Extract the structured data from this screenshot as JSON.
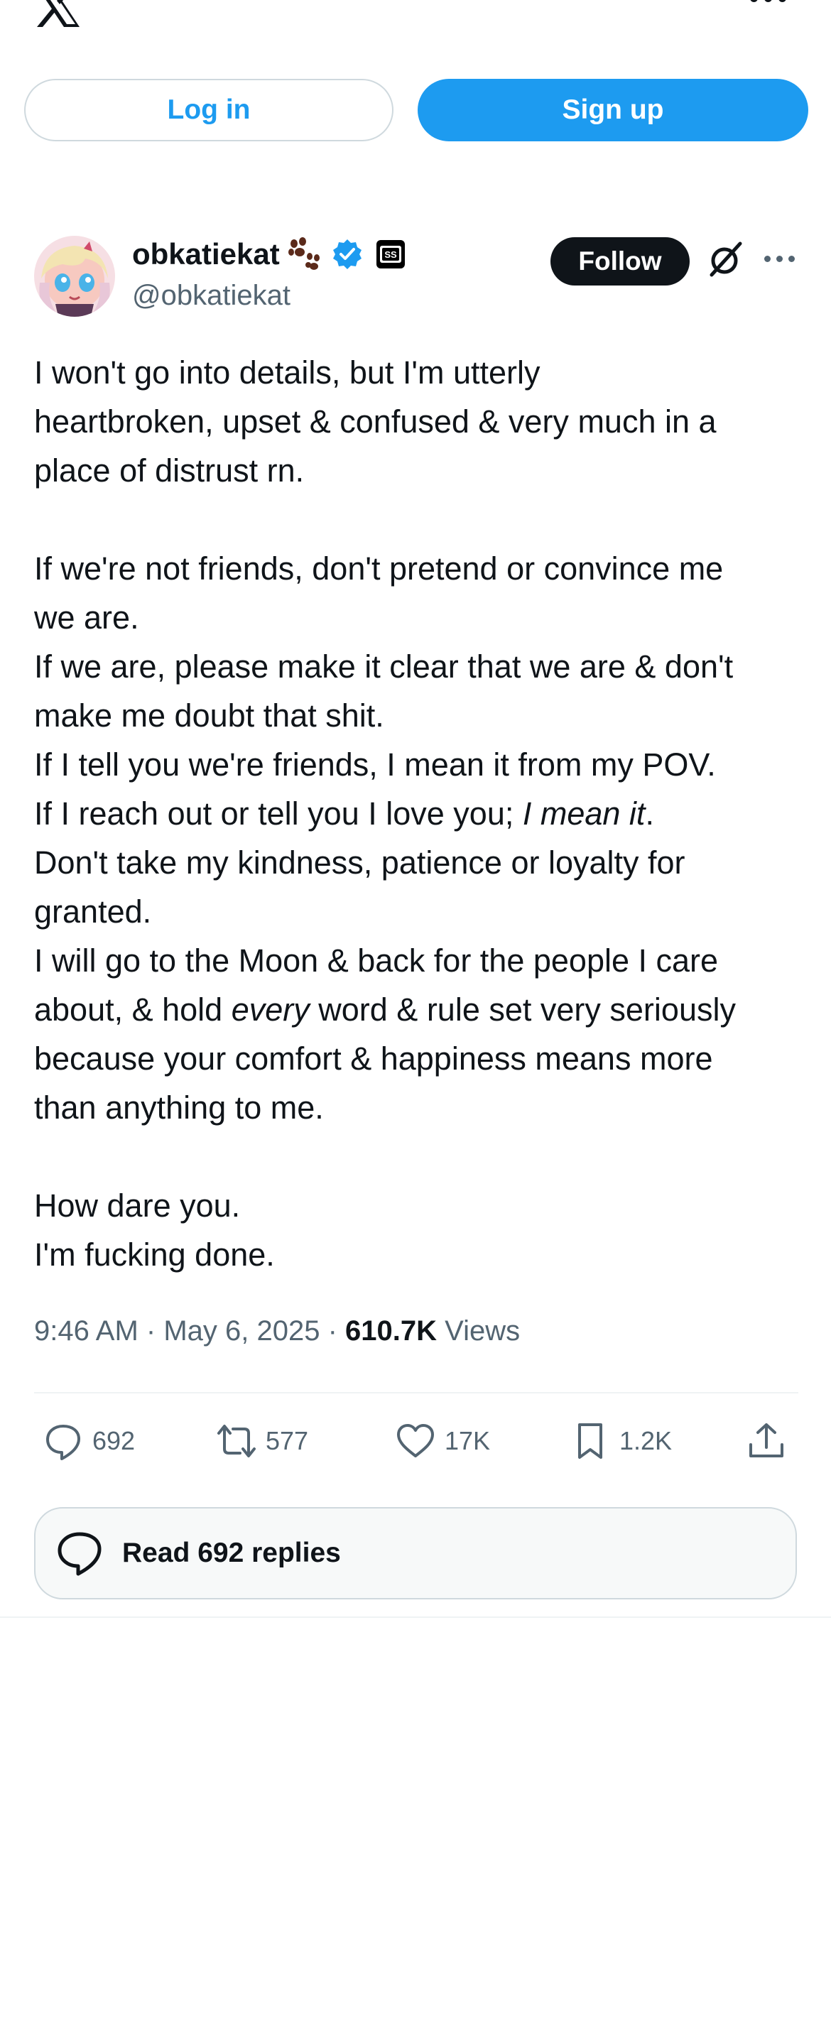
{
  "auth": {
    "login_label": "Log in",
    "signup_label": "Sign up"
  },
  "author": {
    "display_name": "obkatiekat",
    "handle": "@obkatiekat",
    "verified": true,
    "follow_label": "Follow"
  },
  "tweet": {
    "lines": [
      "I won't go into details, but I'm utterly",
      "heartbroken, upset & confused & very much in a",
      "place of distrust rn.",
      "",
      "If we're not friends, don't pretend or convince me",
      "we are.",
      "If we are, please make it clear that we are & don't",
      "make me doubt that shit.",
      "If I tell you we're friends, I mean it from my POV.",
      "If I reach out or tell you I love you; ",
      "I mean it",
      ".",
      "Don't take my kindness, patience or loyalty for",
      "granted.",
      "I will go to the Moon & back for the people I care",
      "about, & hold ",
      "every",
      " word & rule set very seriously",
      "because your comfort & happiness means more",
      "than anything to me.",
      "",
      "How dare you.",
      "I'm fucking done."
    ]
  },
  "meta": {
    "time": "9:46 AM",
    "separator": " · ",
    "date": "May 6, 2025",
    "views_count": "610.7K",
    "views_label": "Views"
  },
  "actions": {
    "replies": "692",
    "reposts": "577",
    "likes": "17K",
    "bookmarks": "1.2K"
  },
  "read_replies_label": "Read 692 replies",
  "colors": {
    "accent": "#1d9bf0",
    "text": "#0f1419",
    "muted": "#536471",
    "border": "#cfd9de"
  }
}
